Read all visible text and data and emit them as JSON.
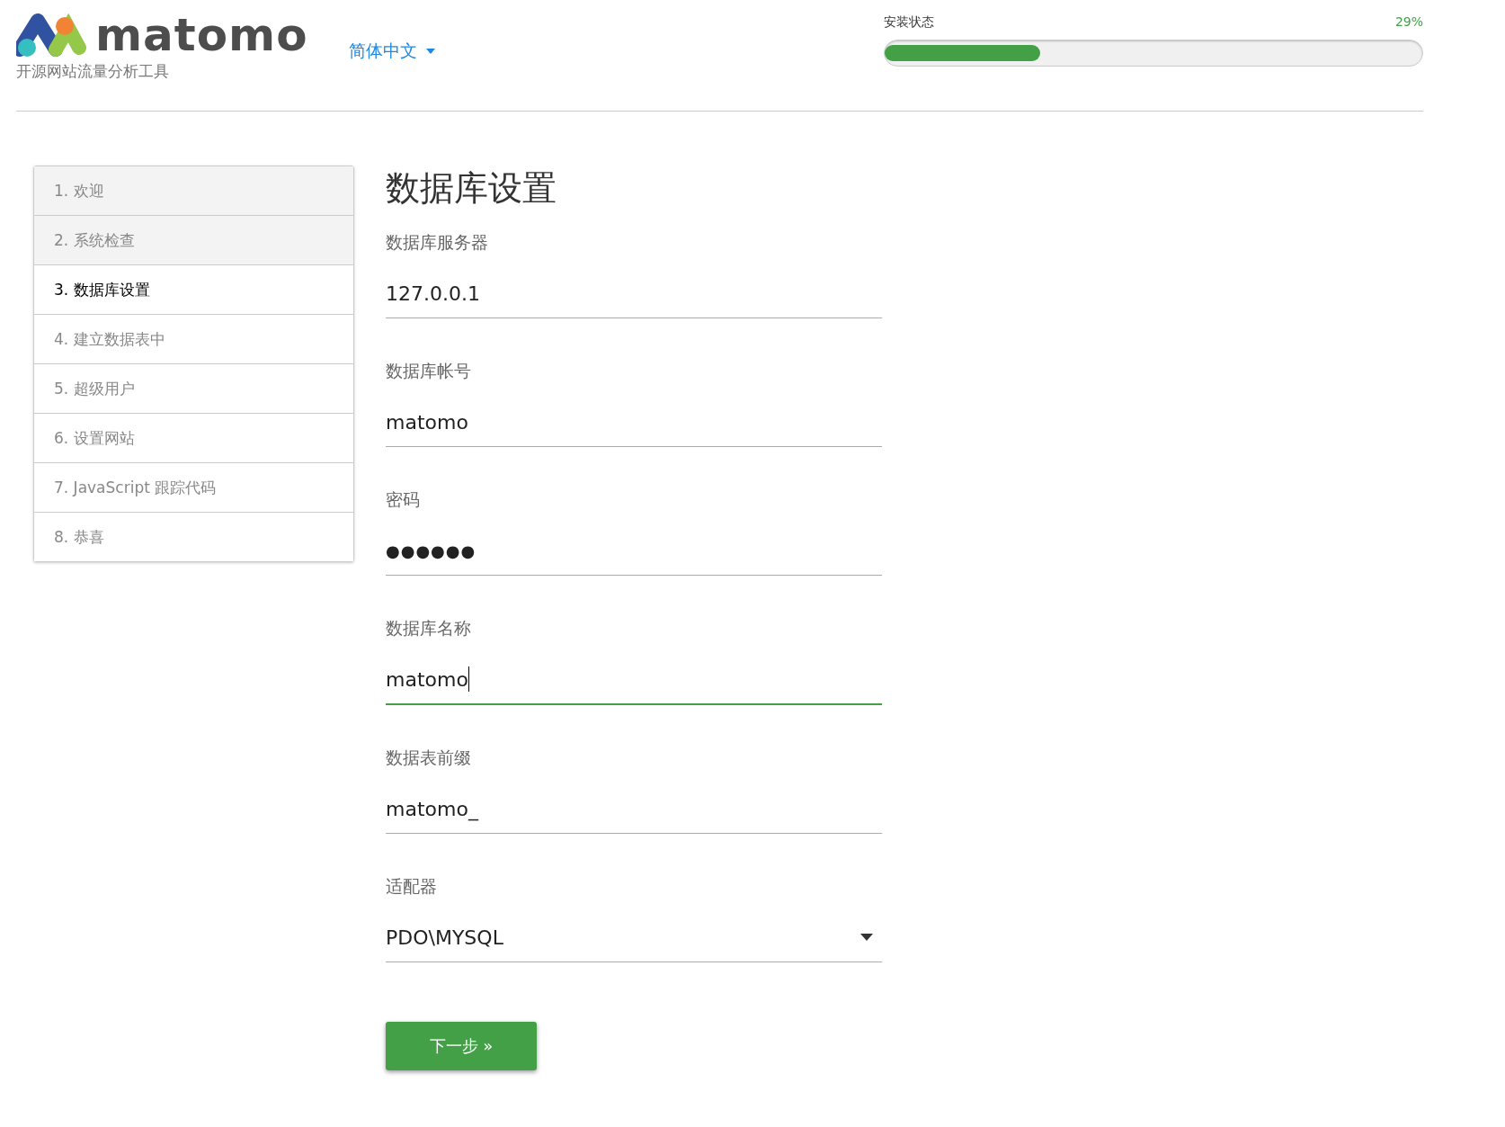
{
  "header": {
    "logo_text": "matomo",
    "tagline": "开源网站流量分析工具",
    "language": "简体中文",
    "progress": {
      "label": "安装状态",
      "percent": "29%",
      "level": 0.29
    }
  },
  "steps": [
    {
      "label": "1. 欢迎",
      "done": true,
      "selected": false
    },
    {
      "label": "2. 系统检查",
      "done": true,
      "selected": false
    },
    {
      "label": "3. 数据库设置",
      "done": false,
      "selected": true
    },
    {
      "label": "4. 建立数据表中",
      "done": false,
      "selected": false
    },
    {
      "label": "5. 超级用户",
      "done": false,
      "selected": false
    },
    {
      "label": "6. 设置网站",
      "done": false,
      "selected": false
    },
    {
      "label": "7. JavaScript 跟踪代码",
      "done": false,
      "selected": false
    },
    {
      "label": "8. 恭喜",
      "done": false,
      "selected": false
    }
  ],
  "title": "数据库设置",
  "fields": [
    {
      "kind": "text",
      "label": "数据库服务器",
      "value": "127.0.0.1",
      "focused": false
    },
    {
      "kind": "text",
      "label": "数据库帐号",
      "value": "matomo",
      "focused": false
    },
    {
      "kind": "password",
      "label": "密码",
      "value": "●●●●●●",
      "focused": false
    },
    {
      "kind": "text",
      "label": "数据库名称",
      "value": "matomo",
      "focused": true
    },
    {
      "kind": "text",
      "label": "数据表前缀",
      "value": "matomo_",
      "focused": false
    },
    {
      "kind": "select",
      "label": "适配器",
      "value": "PDO\\MYSQL",
      "focused": false
    }
  ],
  "next_button": "下一步 »"
}
